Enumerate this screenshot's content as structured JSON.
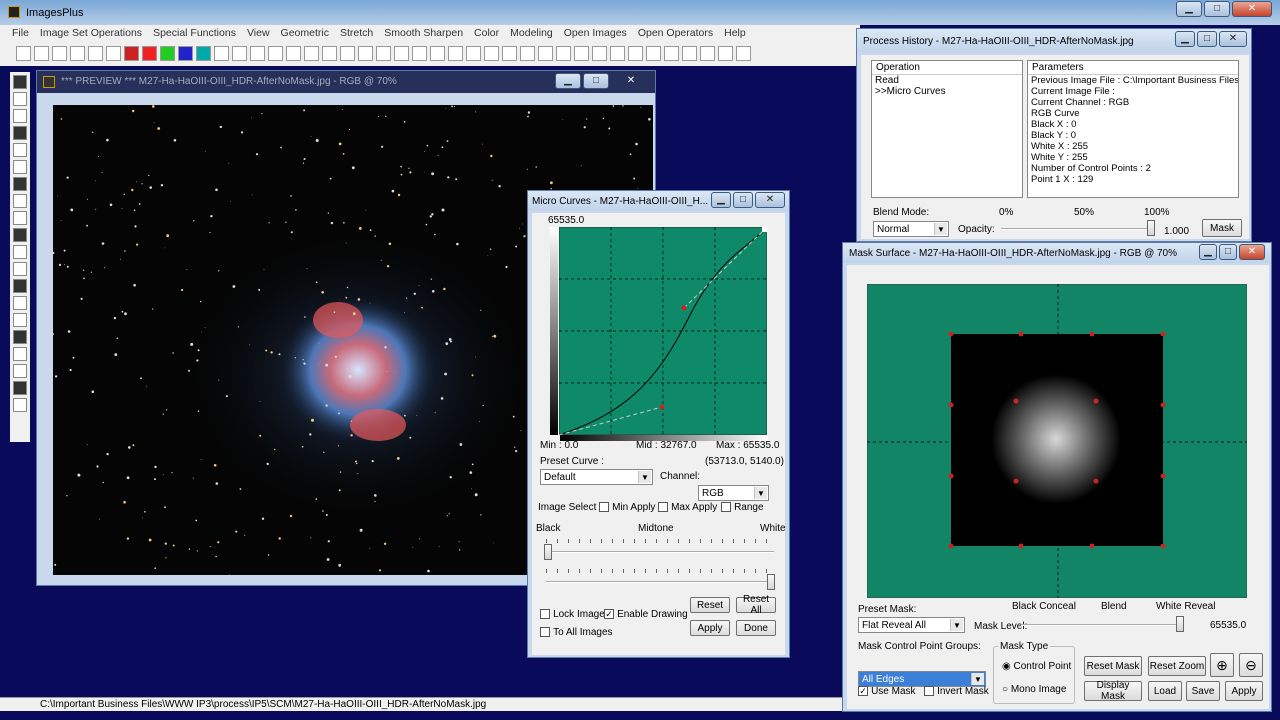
{
  "app": {
    "title": "ImagesPlus"
  },
  "menu": [
    "File",
    "Image Set Operations",
    "Special Functions",
    "View",
    "Geometric",
    "Stretch",
    "Smooth Sharpen",
    "Color",
    "Modeling",
    "Open Images",
    "Open Operators",
    "Help"
  ],
  "preview": {
    "title": "*** PREVIEW *** M27-Ha-HaOIII-OIII_HDR-AfterNoMask.jpg - RGB @ 70%"
  },
  "statusbar": {
    "path": "C:\\Important Business Files\\WWW IP3\\process\\IP5\\SCM\\M27-Ha-HaOIII-OIII_HDR-AfterNoMask.jpg"
  },
  "micro": {
    "title": "Micro Curves - M27-Ha-HaOIII-OIII_H...",
    "top_value": "65535.0",
    "min": "Min : 0.0",
    "mid": "Mid : 32767.0",
    "max": "Max : 65535.0",
    "preset_label": "Preset Curve :",
    "coords": "(53713.0, 5140.0)",
    "preset_value": "Default",
    "channel_label": "Channel:",
    "channel_value": "RGB",
    "image_select": "Image Select",
    "min_apply": "Min Apply",
    "max_apply": "Max Apply",
    "range": "Range",
    "black": "Black",
    "midtone": "Midtone",
    "white": "White",
    "lock_image": "Lock Image",
    "enable_drawing": "Enable Drawing",
    "to_all_images": "To All Images",
    "reset": "Reset",
    "reset_all": "Reset All",
    "apply": "Apply",
    "done": "Done",
    "curve_color": "#0e8a6a"
  },
  "history": {
    "title": "Process History - M27-Ha-HaOIII-OIII_HDR-AfterNoMask.jpg",
    "col_operation": "Operation",
    "col_parameters": "Parameters",
    "operations": [
      "Read",
      ">>Micro Curves"
    ],
    "parameters": [
      "Previous Image File : C:\\Important Business Files\\W",
      "Current Image File :",
      "Current Channel : RGB",
      "RGB Curve",
      " Black X : 0",
      " Black Y : 0",
      " White X : 255",
      " White Y : 255",
      " Number of Control Points : 2",
      "  Point 1 X : 129"
    ],
    "blend_mode_label": "Blend Mode:",
    "pct0": "0%",
    "pct50": "50%",
    "pct100": "100%",
    "blend_value": "Normal",
    "opacity_label": "Opacity:",
    "opacity_value": "1.000",
    "mask_btn": "Mask"
  },
  "mask": {
    "title": "Mask Surface - M27-Ha-HaOIII-OIII_HDR-AfterNoMask.jpg - RGB @ 70%",
    "preset_mask_label": "Preset Mask:",
    "black_conceal": "Black Conceal",
    "blend": "Blend",
    "white_reveal": "White Reveal",
    "preset_value": "Flat Reveal All",
    "mask_level_label": "Mask Level:",
    "mask_level_value": "65535.0",
    "groups_label": "Mask Control Point Groups:",
    "groups_value": "All Edges",
    "mask_type_label": "Mask Type",
    "control_point": "Control Point",
    "mono_image": "Mono Image",
    "use_mask": "Use Mask",
    "invert_mask": "Invert Mask",
    "reset_mask": "Reset Mask",
    "reset_zoom": "Reset Zoom",
    "display_mask": "Display Mask",
    "load": "Load",
    "save": "Save",
    "apply": "Apply",
    "bg_color": "#118565"
  }
}
